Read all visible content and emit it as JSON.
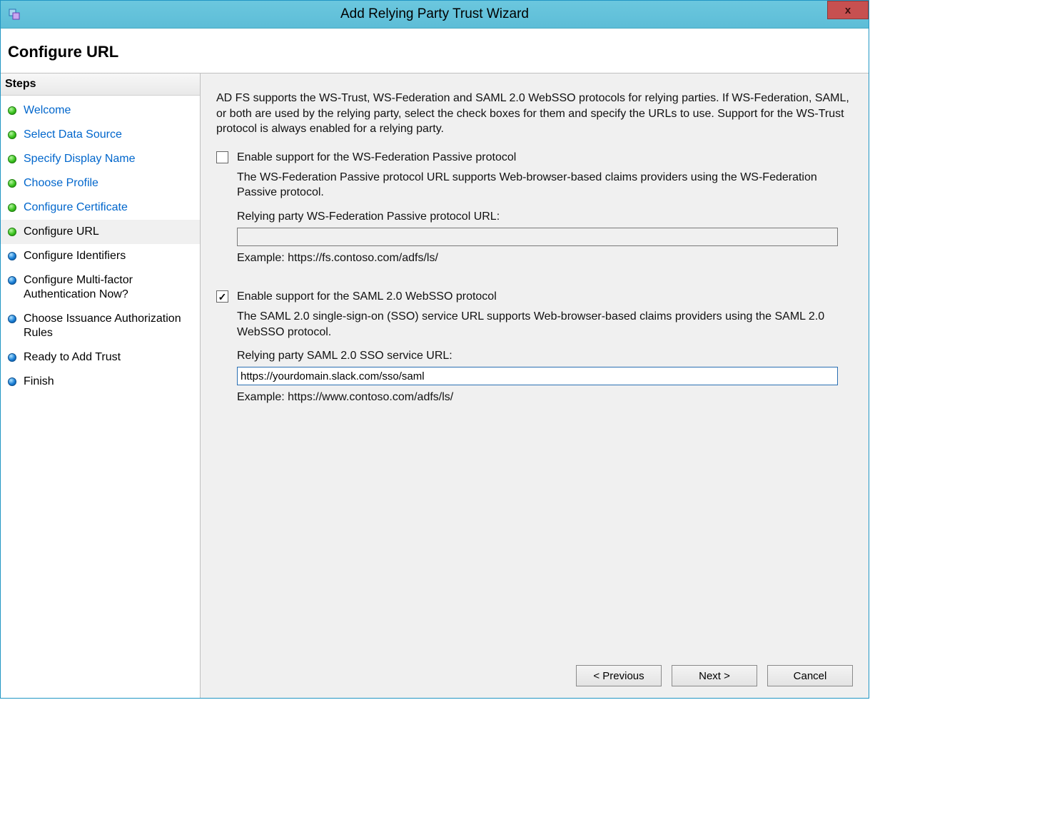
{
  "window": {
    "title": "Add Relying Party Trust Wizard",
    "close_glyph": "x"
  },
  "heading": "Configure URL",
  "sidebar": {
    "steps_header": "Steps",
    "items": [
      {
        "label": "Welcome"
      },
      {
        "label": "Select Data Source"
      },
      {
        "label": "Specify Display Name"
      },
      {
        "label": "Choose Profile"
      },
      {
        "label": "Configure Certificate"
      },
      {
        "label": "Configure URL"
      },
      {
        "label": "Configure Identifiers"
      },
      {
        "label": "Configure Multi-factor Authentication Now?"
      },
      {
        "label": "Choose Issuance Authorization Rules"
      },
      {
        "label": "Ready to Add Trust"
      },
      {
        "label": "Finish"
      }
    ]
  },
  "main": {
    "intro": "AD FS supports the WS-Trust, WS-Federation and SAML 2.0 WebSSO protocols for relying parties.  If WS-Federation, SAML, or both are used by the relying party, select the check boxes for them and specify the URLs to use.  Support for the WS-Trust protocol is always enabled for a relying party.",
    "wsfed": {
      "checkbox_label": "Enable support for the WS-Federation Passive protocol",
      "checked": false,
      "desc": "The WS-Federation Passive protocol URL supports Web-browser-based claims providers using the WS-Federation Passive protocol.",
      "url_label": "Relying party WS-Federation Passive protocol URL:",
      "url_value": "",
      "example": "Example: https://fs.contoso.com/adfs/ls/"
    },
    "saml": {
      "checkbox_label": "Enable support for the SAML 2.0 WebSSO protocol",
      "checked": true,
      "desc": "The SAML 2.0 single-sign-on (SSO) service URL supports Web-browser-based claims providers using the SAML 2.0 WebSSO protocol.",
      "url_label": "Relying party SAML 2.0 SSO service URL:",
      "url_value": "https://yourdomain.slack.com/sso/saml",
      "example": "Example: https://www.contoso.com/adfs/ls/"
    }
  },
  "buttons": {
    "previous": "< Previous",
    "next": "Next >",
    "cancel": "Cancel"
  }
}
